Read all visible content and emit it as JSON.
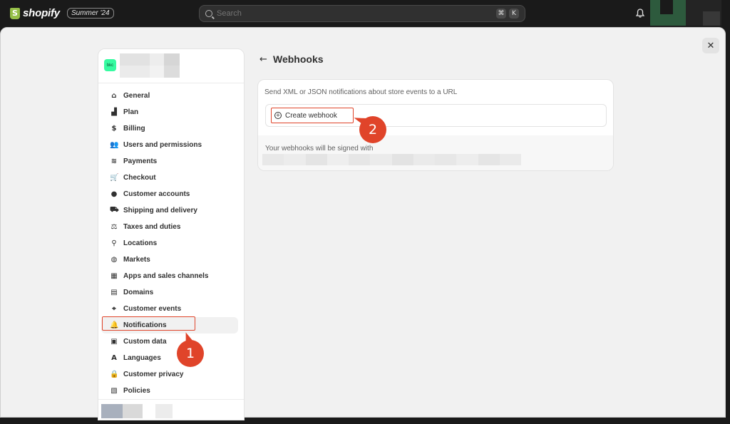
{
  "topbar": {
    "brand": "shopify",
    "edition": "Summer '24",
    "search_placeholder": "Search",
    "shortcut_mod": "⌘",
    "shortcut_key": "K"
  },
  "sidebar": {
    "store_badge": "bkc",
    "items": [
      {
        "label": "General",
        "icon": "store-icon",
        "glyph": "⌂"
      },
      {
        "label": "Plan",
        "icon": "plan-chart-icon",
        "glyph": "▟"
      },
      {
        "label": "Billing",
        "icon": "billing-icon",
        "glyph": "$"
      },
      {
        "label": "Users and permissions",
        "icon": "users-icon",
        "glyph": "👥"
      },
      {
        "label": "Payments",
        "icon": "payments-icon",
        "glyph": "≋"
      },
      {
        "label": "Checkout",
        "icon": "cart-icon",
        "glyph": "🛒"
      },
      {
        "label": "Customer accounts",
        "icon": "person-icon",
        "glyph": "●"
      },
      {
        "label": "Shipping and delivery",
        "icon": "truck-icon",
        "glyph": "⛟"
      },
      {
        "label": "Taxes and duties",
        "icon": "tax-icon",
        "glyph": "⚖"
      },
      {
        "label": "Locations",
        "icon": "location-pin-icon",
        "glyph": "⚲"
      },
      {
        "label": "Markets",
        "icon": "globe-icon",
        "glyph": "◍"
      },
      {
        "label": "Apps and sales channels",
        "icon": "apps-icon",
        "glyph": "▦"
      },
      {
        "label": "Domains",
        "icon": "domains-icon",
        "glyph": "▤"
      },
      {
        "label": "Customer events",
        "icon": "cursor-click-icon",
        "glyph": "⌖"
      },
      {
        "label": "Notifications",
        "icon": "bell-icon",
        "glyph": "🔔"
      },
      {
        "label": "Custom data",
        "icon": "custom-data-icon",
        "glyph": "▣"
      },
      {
        "label": "Languages",
        "icon": "language-icon",
        "glyph": "A"
      },
      {
        "label": "Customer privacy",
        "icon": "lock-icon",
        "glyph": "🔒"
      },
      {
        "label": "Policies",
        "icon": "policies-icon",
        "glyph": "▧"
      }
    ]
  },
  "main": {
    "title": "Webhooks",
    "description": "Send XML or JSON notifications about store events to a URL",
    "create_button": "Create webhook",
    "signed_text": "Your webhooks will be signed with"
  },
  "annotations": {
    "step1": "1",
    "step2": "2"
  },
  "colors": {
    "annotation": "#e0442a",
    "brand_green": "#95bf47",
    "store_badge": "#36fba1"
  }
}
